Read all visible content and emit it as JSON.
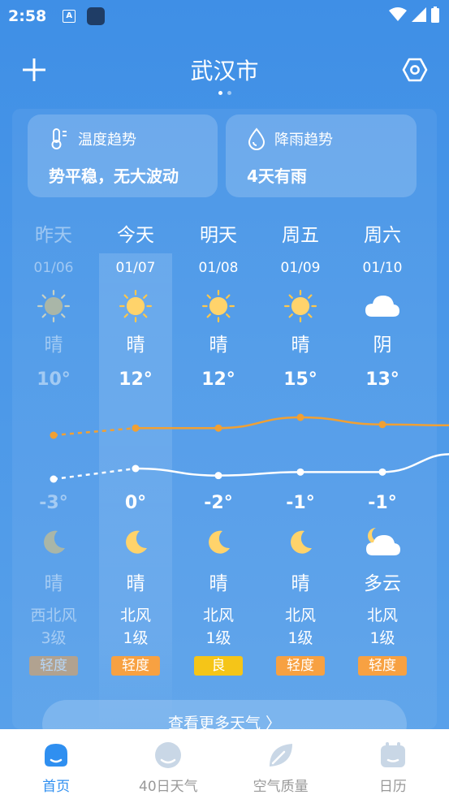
{
  "status": {
    "time": "2:58",
    "a_badge": "A"
  },
  "header": {
    "city": "武汉市"
  },
  "trends": {
    "temp": {
      "title": "温度趋势",
      "text": "势平稳，无大波动"
    },
    "rain": {
      "title": "降雨趋势",
      "text": "4天有雨"
    }
  },
  "days": [
    {
      "day": "昨天",
      "date": "01/06",
      "day_icon": "sun-icon",
      "cond_day": "晴",
      "high": "10°",
      "low": "-3°",
      "night_icon": "moon-icon",
      "cond_night": "晴",
      "wind": "西北风",
      "wind_level": "3级",
      "aqi": "轻度",
      "aqi_color": "#f4a248",
      "past": true
    },
    {
      "day": "今天",
      "date": "01/07",
      "day_icon": "sun-icon",
      "cond_day": "晴",
      "high": "12°",
      "low": "0°",
      "night_icon": "moon-icon",
      "cond_night": "晴",
      "wind": "北风",
      "wind_level": "1级",
      "aqi": "轻度",
      "aqi_color": "#f7a142",
      "past": false
    },
    {
      "day": "明天",
      "date": "01/08",
      "day_icon": "sun-icon",
      "cond_day": "晴",
      "high": "12°",
      "low": "-2°",
      "night_icon": "moon-icon",
      "cond_night": "晴",
      "wind": "北风",
      "wind_level": "1级",
      "aqi": "良",
      "aqi_color": "#f5c518",
      "past": false
    },
    {
      "day": "周五",
      "date": "01/09",
      "day_icon": "sun-icon",
      "cond_day": "晴",
      "high": "15°",
      "low": "-1°",
      "night_icon": "moon-icon",
      "cond_night": "晴",
      "wind": "北风",
      "wind_level": "1级",
      "aqi": "轻度",
      "aqi_color": "#f7a142",
      "past": false
    },
    {
      "day": "周六",
      "date": "01/10",
      "day_icon": "cloud-icon",
      "cond_day": "阴",
      "high": "13°",
      "low": "-1°",
      "night_icon": "moon-cloud-icon",
      "cond_night": "多云",
      "wind": "北风",
      "wind_level": "1级",
      "aqi": "轻度",
      "aqi_color": "#f7a142",
      "past": false
    }
  ],
  "high_values": [
    10,
    12,
    12,
    15,
    13
  ],
  "low_values": [
    -3,
    0,
    -2,
    -1,
    -1
  ],
  "more_button": "查看更多天气 〉",
  "tabs": [
    {
      "label": "首页",
      "icon": "home-icon",
      "active": true
    },
    {
      "label": "40日天气",
      "icon": "cloud-icon",
      "active": false
    },
    {
      "label": "空气质量",
      "icon": "leaf-icon",
      "active": false
    },
    {
      "label": "日历",
      "icon": "calendar-icon",
      "active": false
    }
  ],
  "colors": {
    "accent": "#2f8ff0",
    "high_line": "#f0a034",
    "low_line": "#ffffff"
  }
}
